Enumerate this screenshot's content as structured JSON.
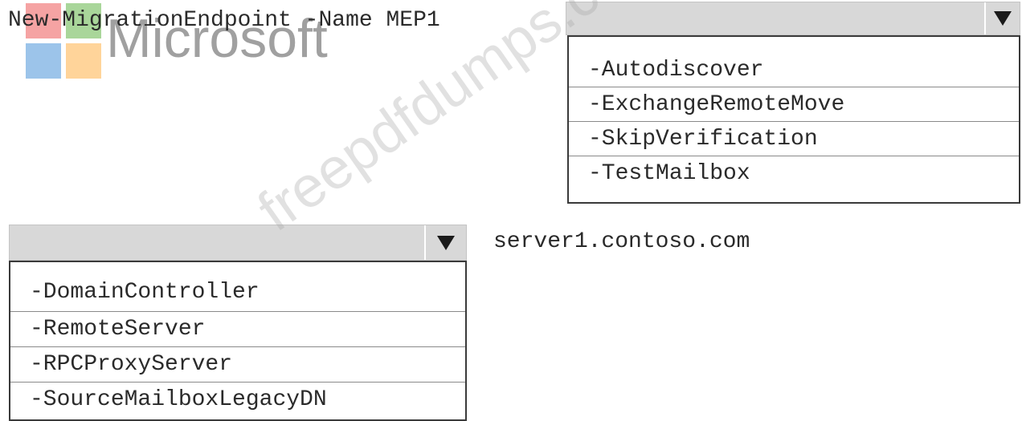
{
  "logo": {
    "word": "Microsoft",
    "colors": [
      "#f5a3a3",
      "#a9d69a",
      "#9cc4ea",
      "#ffd49a"
    ]
  },
  "command": {
    "text": "New-MigrationEndpoint -Name MEP1"
  },
  "dropdown1": {
    "selected": "",
    "options": [
      "-Autodiscover",
      "-ExchangeRemoteMove",
      "-SkipVerification",
      "-TestMailbox"
    ]
  },
  "dropdown2": {
    "selected": "",
    "options": [
      "-DomainController",
      "-RemoteServer",
      "-RPCProxyServer",
      "-SourceMailboxLegacyDN"
    ]
  },
  "server": {
    "text": "server1.contoso.com"
  },
  "watermark": {
    "text": "freepdfdumps.com"
  }
}
